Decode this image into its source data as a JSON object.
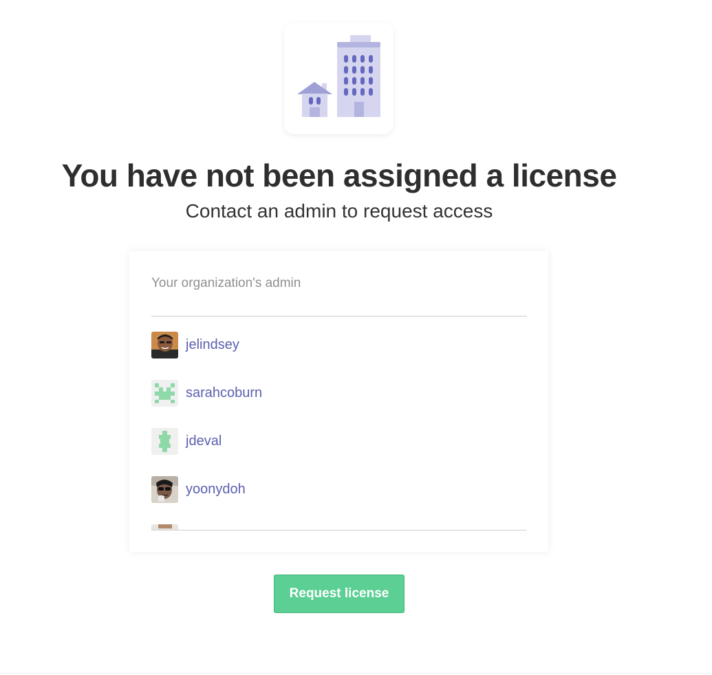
{
  "illustration": {
    "icon": "office-buildings-icon",
    "colors": {
      "light": "#d5d5f0",
      "mid": "#b4b4e0",
      "dark": "#6668bf"
    }
  },
  "header": {
    "title": "You have not been assigned a license",
    "subtitle": "Contact an admin to request access"
  },
  "admin_panel": {
    "label": "Your organization's admin",
    "admins": [
      {
        "username": "jelindsey",
        "avatar": "photo-avatar"
      },
      {
        "username": "sarahcoburn",
        "avatar": "identicon-avatar"
      },
      {
        "username": "jdeval",
        "avatar": "identicon-avatar"
      },
      {
        "username": "yoonydoh",
        "avatar": "photo-avatar"
      },
      {
        "username": "",
        "avatar": "photo-avatar"
      }
    ]
  },
  "actions": {
    "request_label": "Request license"
  },
  "colors": {
    "link": "#5b5fae",
    "primary_button": "#5ccf94",
    "identicon": "#8fd9a8"
  }
}
